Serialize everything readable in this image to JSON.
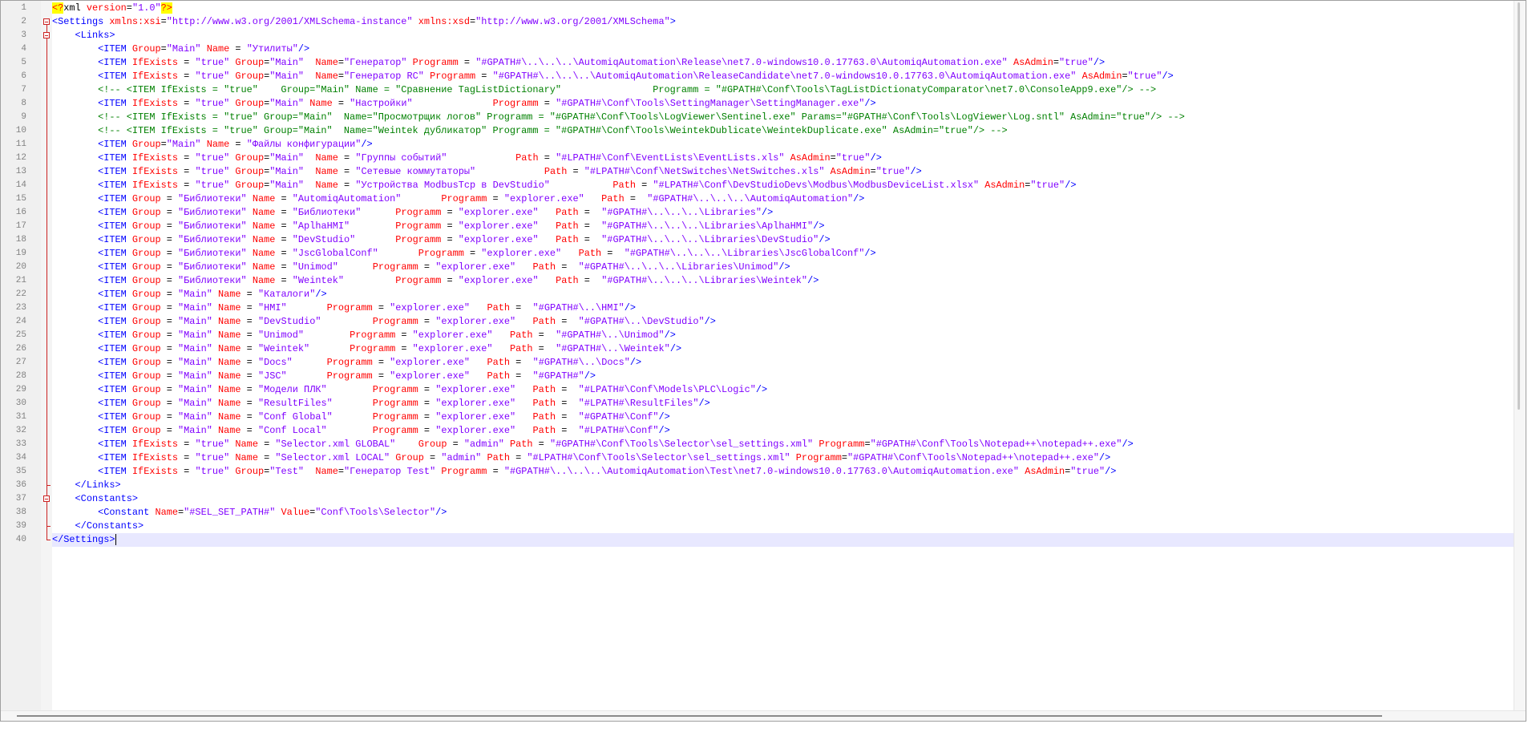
{
  "editor": {
    "language": "xml",
    "current_line": 40,
    "colors": {
      "tag": "#0000ff",
      "attribute": "#ff0000",
      "value": "#8000ff",
      "comment": "#008000",
      "processing_instruction_bg": "#ffff00",
      "current_line_bg": "#e8e8ff"
    },
    "lines": [
      "<?xml version=\"1.0\"?>",
      "<Settings xmlns:xsi=\"http://www.w3.org/2001/XMLSchema-instance\" xmlns:xsd=\"http://www.w3.org/2001/XMLSchema\">",
      "    <Links>",
      "        <ITEM Group=\"Main\" Name = \"Утилиты\"/>",
      "        <ITEM IfExists = \"true\" Group=\"Main\"  Name=\"Генератор\" Programm = \"#GPATH#\\..\\..\\..\\AutomiqAutomation\\Release\\net7.0-windows10.0.17763.0\\AutomiqAutomation.exe\" AsAdmin=\"true\"/>",
      "        <ITEM IfExists = \"true\" Group=\"Main\"  Name=\"Генератор RC\" Programm = \"#GPATH#\\..\\..\\..\\AutomiqAutomation\\ReleaseCandidate\\net7.0-windows10.0.17763.0\\AutomiqAutomation.exe\" AsAdmin=\"true\"/>",
      "        <!-- <ITEM IfExists = \"true\"    Group=\"Main\" Name = \"Сравнение TagListDictionary\"                Programm = \"#GPATH#\\Conf\\Tools\\TagListDictionatyComparator\\net7.0\\ConsoleApp9.exe\"/> -->",
      "        <ITEM IfExists = \"true\" Group=\"Main\" Name = \"Настройки\"              Programm = \"#GPATH#\\Conf\\Tools\\SettingManager\\SettingManager.exe\"/>",
      "        <!-- <ITEM IfExists = \"true\" Group=\"Main\"  Name=\"Просмотрщик логов\" Programm = \"#GPATH#\\Conf\\Tools\\LogViewer\\Sentinel.exe\" Params=\"#GPATH#\\Conf\\Tools\\LogViewer\\Log.sntl\" AsAdmin=\"true\"/> -->",
      "        <!-- <ITEM IfExists = \"true\" Group=\"Main\"  Name=\"Weintek дубликатор\" Programm = \"#GPATH#\\Conf\\Tools\\WeintekDublicate\\WeintekDuplicate.exe\" AsAdmin=\"true\"/> -->",
      "        <ITEM Group=\"Main\" Name = \"Файлы конфигурации\"/>",
      "        <ITEM IfExists = \"true\" Group=\"Main\"  Name = \"Группы событий\"            Path = \"#LPATH#\\Conf\\EventLists\\EventLists.xls\" AsAdmin=\"true\"/>",
      "        <ITEM IfExists = \"true\" Group=\"Main\"  Name = \"Сетевые коммутаторы\"            Path = \"#LPATH#\\Conf\\NetSwitches\\NetSwitches.xls\" AsAdmin=\"true\"/>",
      "        <ITEM IfExists = \"true\" Group=\"Main\"  Name = \"Устройства ModbusTcp в DevStudio\"           Path = \"#LPATH#\\Conf\\DevStudioDevs\\Modbus\\ModbusDeviceList.xlsx\" AsAdmin=\"true\"/>",
      "        <ITEM Group = \"Библиотеки\" Name = \"AutomiqAutomation\"       Programm = \"explorer.exe\"   Path =  \"#GPATH#\\..\\..\\..\\AutomiqAutomation\"/>",
      "        <ITEM Group = \"Библиотеки\" Name = \"Библиотеки\"      Programm = \"explorer.exe\"   Path =  \"#GPATH#\\..\\..\\..\\Libraries\"/>",
      "        <ITEM Group = \"Библиотеки\" Name = \"AplhaHMI\"        Programm = \"explorer.exe\"   Path =  \"#GPATH#\\..\\..\\..\\Libraries\\AplhaHMI\"/>",
      "        <ITEM Group = \"Библиотеки\" Name = \"DevStudio\"       Programm = \"explorer.exe\"   Path =  \"#GPATH#\\..\\..\\..\\Libraries\\DevStudio\"/>",
      "        <ITEM Group = \"Библиотеки\" Name = \"JscGlobalConf\"       Programm = \"explorer.exe\"   Path =  \"#GPATH#\\..\\..\\..\\Libraries\\JscGlobalConf\"/>",
      "        <ITEM Group = \"Библиотеки\" Name = \"Unimod\"      Programm = \"explorer.exe\"   Path =  \"#GPATH#\\..\\..\\..\\Libraries\\Unimod\"/>",
      "        <ITEM Group = \"Библиотеки\" Name = \"Weintek\"         Programm = \"explorer.exe\"   Path =  \"#GPATH#\\..\\..\\..\\Libraries\\Weintek\"/>",
      "        <ITEM Group = \"Main\" Name = \"Каталоги\"/>",
      "        <ITEM Group = \"Main\" Name = \"HMI\"       Programm = \"explorer.exe\"   Path =  \"#GPATH#\\..\\HMI\"/>",
      "        <ITEM Group = \"Main\" Name = \"DevStudio\"         Programm = \"explorer.exe\"   Path =  \"#GPATH#\\..\\DevStudio\"/>",
      "        <ITEM Group = \"Main\" Name = \"Unimod\"        Programm = \"explorer.exe\"   Path =  \"#GPATH#\\..\\Unimod\"/>",
      "        <ITEM Group = \"Main\" Name = \"Weintek\"       Programm = \"explorer.exe\"   Path =  \"#GPATH#\\..\\Weintek\"/>",
      "        <ITEM Group = \"Main\" Name = \"Docs\"      Programm = \"explorer.exe\"   Path =  \"#GPATH#\\..\\Docs\"/>",
      "        <ITEM Group = \"Main\" Name = \"JSC\"       Programm = \"explorer.exe\"   Path =  \"#GPATH#\"/>",
      "        <ITEM Group = \"Main\" Name = \"Модели ПЛК\"        Programm = \"explorer.exe\"   Path =  \"#LPATH#\\Conf\\Models\\PLC\\Logic\"/>",
      "        <ITEM Group = \"Main\" Name = \"ResultFiles\"       Programm = \"explorer.exe\"   Path =  \"#LPATH#\\ResultFiles\"/>",
      "        <ITEM Group = \"Main\" Name = \"Conf Global\"       Programm = \"explorer.exe\"   Path =  \"#GPATH#\\Conf\"/>",
      "        <ITEM Group = \"Main\" Name = \"Conf Local\"        Programm = \"explorer.exe\"   Path =  \"#LPATH#\\Conf\"/>",
      "        <ITEM IfExists = \"true\" Name = \"Selector.xml GLOBAL\"    Group = \"admin\" Path = \"#GPATH#\\Conf\\Tools\\Selector\\sel_settings.xml\" Programm=\"#GPATH#\\Conf\\Tools\\Notepad++\\notepad++.exe\"/>",
      "        <ITEM IfExists = \"true\" Name = \"Selector.xml LOCAL\" Group = \"admin\" Path = \"#LPATH#\\Conf\\Tools\\Selector\\sel_settings.xml\" Programm=\"#GPATH#\\Conf\\Tools\\Notepad++\\notepad++.exe\"/>",
      "        <ITEM IfExists = \"true\" Group=\"Test\"  Name=\"Генератор Test\" Programm = \"#GPATH#\\..\\..\\..\\AutomiqAutomation\\Test\\net7.0-windows10.0.17763.0\\AutomiqAutomation.exe\" AsAdmin=\"true\"/>",
      "    </Links>",
      "    <Constants>",
      "        <Constant Name=\"#SEL_SET_PATH#\" Value=\"Conf\\Tools\\Selector\"/>",
      "    </Constants>",
      "</Settings>"
    ]
  }
}
